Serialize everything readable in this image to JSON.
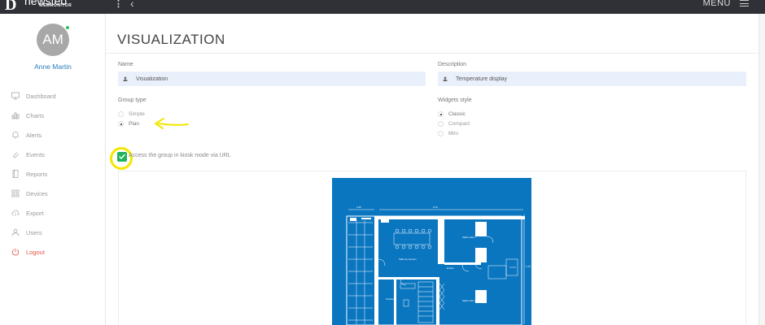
{
  "topbar": {
    "logo_mark": "D",
    "logo_text": "newsteo",
    "logo_sub": "WEBMONITOR",
    "menu_label": "MENU"
  },
  "user": {
    "initials": "AM",
    "name": "Anne Martin"
  },
  "nav": [
    {
      "label": "Dashboard",
      "icon": "monitor-icon"
    },
    {
      "label": "Charts",
      "icon": "bar-chart-icon"
    },
    {
      "label": "Alerts",
      "icon": "bell-icon"
    },
    {
      "label": "Events",
      "icon": "paperclip-icon"
    },
    {
      "label": "Reports",
      "icon": "book-icon"
    },
    {
      "label": "Devices",
      "icon": "grid-icon"
    },
    {
      "label": "Export",
      "icon": "cloud-upload-icon"
    },
    {
      "label": "Users",
      "icon": "user-icon"
    },
    {
      "label": "Logout",
      "icon": "power-icon"
    }
  ],
  "page": {
    "title": "VISUALIZATION",
    "name_label": "Name",
    "name_value": "Visualization",
    "description_label": "Description",
    "description_value": "Temperature display",
    "group_type_label": "Group type",
    "group_type_options": [
      "Simple",
      "Plan"
    ],
    "group_type_selected": "Plan",
    "widgets_style_label": "Widgets style",
    "widgets_style_options": [
      "Classic",
      "Compact",
      "Mini"
    ],
    "widgets_style_selected": "Classic",
    "kiosk_label": "Access the group in kiosk mode via URL",
    "kiosk_checked": true
  },
  "plan": {
    "dim_left": "2.29",
    "dim_top": "9.70",
    "dim_right": "6.75",
    "room_1": "Salle de réunion",
    "room_2": "Salle Labo 1",
    "room_3": "Salle Labo 2",
    "room_4": "Cuisine",
    "room_5": "Entrée"
  },
  "colors": {
    "accent": "#2a7dbb",
    "checkbox": "#22b25b",
    "annotation": "#f3e600",
    "plan_bg": "#0a76c0",
    "logout": "#e25848"
  }
}
